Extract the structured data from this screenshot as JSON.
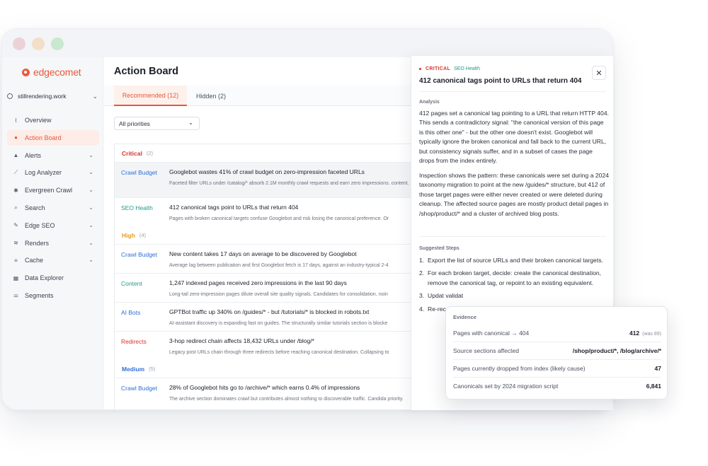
{
  "brand": {
    "name": "edgecomet",
    "color": "#e8573a"
  },
  "site": "stillrendering.work",
  "sidebar": {
    "items": [
      {
        "label": "Overview",
        "icon": "overview-icon",
        "chevron": false
      },
      {
        "label": "Action Board",
        "icon": "lightbulb-icon",
        "chevron": false,
        "active": true
      },
      {
        "label": "Alerts",
        "icon": "bell-icon",
        "chevron": true
      },
      {
        "label": "Log Analyzer",
        "icon": "chart-icon",
        "chevron": true
      },
      {
        "label": "Evergreen Crawl",
        "icon": "bug-icon",
        "chevron": true
      },
      {
        "label": "Search",
        "icon": "search-icon",
        "chevron": true
      },
      {
        "label": "Edge SEO",
        "icon": "edit-icon",
        "chevron": true
      },
      {
        "label": "Renders",
        "icon": "layers-icon",
        "chevron": true
      },
      {
        "label": "Cache",
        "icon": "database-icon",
        "chevron": true
      },
      {
        "label": "Data Explorer",
        "icon": "table-icon",
        "chevron": false
      },
      {
        "label": "Segments",
        "icon": "sliders-icon",
        "chevron": false
      }
    ]
  },
  "main": {
    "title": "Action Board",
    "tabs": [
      {
        "label": "Recommended (12)",
        "active": true
      },
      {
        "label": "Hidden (2)",
        "active": false
      }
    ],
    "filter": "All priorities",
    "groups": [
      {
        "label": "Critical",
        "count": "(2)",
        "color": "#d9342b",
        "rows": [
          {
            "category": "Crawl Budget",
            "cat_color": "#2f6fd6",
            "title": "Googlebot wastes 41% of crawl budget on zero-impression faceted URLs",
            "desc": "Faceted filter URLs under /catalog/* absorb 2.1M monthly crawl requests and earn zero impressions. content.",
            "selected": true
          },
          {
            "category": "SEO Health",
            "cat_color": "#1e9c8a",
            "title": "412 canonical tags point to URLs that return 404",
            "desc": "Pages with broken canonical targets confuse Googlebot and risk losing the canonical preference. Or"
          }
        ]
      },
      {
        "label": "High",
        "count": "(4)",
        "color": "#e79a1e",
        "rows": [
          {
            "category": "Crawl Budget",
            "cat_color": "#2f6fd6",
            "title": "New content takes 17 days on average to be discovered by Googlebot",
            "desc": "Average lag between publication and first Googlebot fetch is 17 days, against an industry-typical 2-4"
          },
          {
            "category": "Content",
            "cat_color": "#1e9c8a",
            "title": "1,247 indexed pages received zero impressions in the last 90 days",
            "desc": "Long-tail zero-impression pages dilute overall site quality signals. Candidates for consolidation, noin"
          },
          {
            "category": "AI Bots",
            "cat_color": "#2f6fd6",
            "title": "GPTBot traffic up 340% on /guides/* - but /tutorials/* is blocked in robots.txt",
            "desc": "AI-assistant discovery is expanding fast on guides. The structurally similar tutorials section is blocke"
          },
          {
            "category": "Redirects",
            "cat_color": "#d9342b",
            "title": "3-hop redirect chain affects 18,432 URLs under /blog/*",
            "desc": "Legacy post URLs chain through three redirects before reaching canonical destination. Collapsing to"
          }
        ]
      },
      {
        "label": "Medium",
        "count": "(5)",
        "color": "#2f6fd6",
        "rows": [
          {
            "category": "Crawl Budget",
            "cat_color": "#2f6fd6",
            "title": "28% of Googlebot hits go to /archive/* which earns 0.4% of impressions",
            "desc": "The archive section dominates crawl but contributes almost nothing to discoverable traffic. Candida priority.",
            "wrap": true
          }
        ]
      }
    ]
  },
  "panel": {
    "severity": "CRITICAL",
    "category": "SEO Health",
    "title": "412 canonical tags point to URLs that return 404",
    "analysis_heading": "Analysis",
    "analysis_p1": "412 pages set a canonical tag pointing to a URL that return HTTP 404. This sends a contradictory signal: \"the canonical version of this page is this other one\" - but the other one doesn't exist. Googlebot will typically ignore the broken canonical and fall back to the current URL, but consistency signals suffer, and in a subset of cases the page drops from the index entirely.",
    "analysis_p2": "Inspection shows the pattern: these canonicals were set during a 2024 taxonomy migration to point at the new /guides/* structure, but 412 of those target pages were either never created or were deleted during cleanup. The affected source pages are mostly product detail pages in /shop/product/* and a cluster of archived blog posts.",
    "steps_heading": "Suggested Steps",
    "steps": [
      {
        "n": "1.",
        "text": "Export the list of source URLs and their broken canonical targets."
      },
      {
        "n": "2.",
        "text": "For each broken target, decide: create the canonical destination, remove the canonical tag, or repoint to an existing equivalent."
      },
      {
        "n": "3.",
        "text": "Updat validat"
      },
      {
        "n": "4.",
        "text": "Re-rec Conso"
      }
    ]
  },
  "evidence": {
    "heading": "Evidence",
    "rows": [
      {
        "label": "Pages with canonical → 404",
        "value": "412",
        "note": "(was 89)"
      },
      {
        "label": "Source sections affected",
        "value": "/shop/product/*, /blog/archive/*",
        "note": ""
      },
      {
        "label": "Pages currently dropped from index (likely cause)",
        "value": "47",
        "note": ""
      },
      {
        "label": "Canonicals set by 2024 migration script",
        "value": "6,841",
        "note": ""
      }
    ]
  }
}
